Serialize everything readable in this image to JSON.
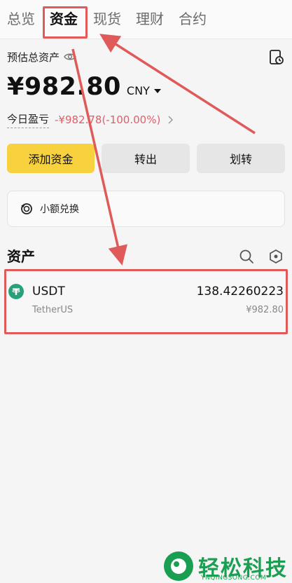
{
  "tabs": [
    {
      "label": "总览",
      "active": false
    },
    {
      "label": "资金",
      "active": true
    },
    {
      "label": "现货",
      "active": false
    },
    {
      "label": "理财",
      "active": false
    },
    {
      "label": "合约",
      "active": false
    }
  ],
  "summary": {
    "est_label": "预估总资产",
    "amount": "¥982.80",
    "currency": "CNY",
    "pnl_label": "今日盈亏",
    "pnl_value": "-¥982.78(-100.00%)"
  },
  "actions": {
    "add_funds": "添加资金",
    "withdraw": "转出",
    "transfer": "划转"
  },
  "small_exchange": {
    "label": "小额兑换"
  },
  "assets": {
    "title": "资产",
    "items": [
      {
        "symbol": "USDT",
        "name": "TetherUS",
        "quantity": "138.42260223",
        "fiat_value": "¥982.80"
      }
    ]
  },
  "watermark": {
    "text": "轻松科技",
    "sub": "YNQINGSONG.COM"
  },
  "colors": {
    "accent_yellow": "#f7d23e",
    "loss_red": "#e35d6a",
    "annotation_red": "#e05a5a",
    "usdt_green": "#26a17b",
    "watermark_green": "#1a9f52"
  },
  "icons": {
    "visibility": "eye-icon",
    "history": "history-icon",
    "exchange": "exchange-icon",
    "search": "search-icon",
    "settings": "hexagon-settings-icon",
    "coin": "usdt-coin-icon",
    "more": "chevron-right-icon"
  }
}
